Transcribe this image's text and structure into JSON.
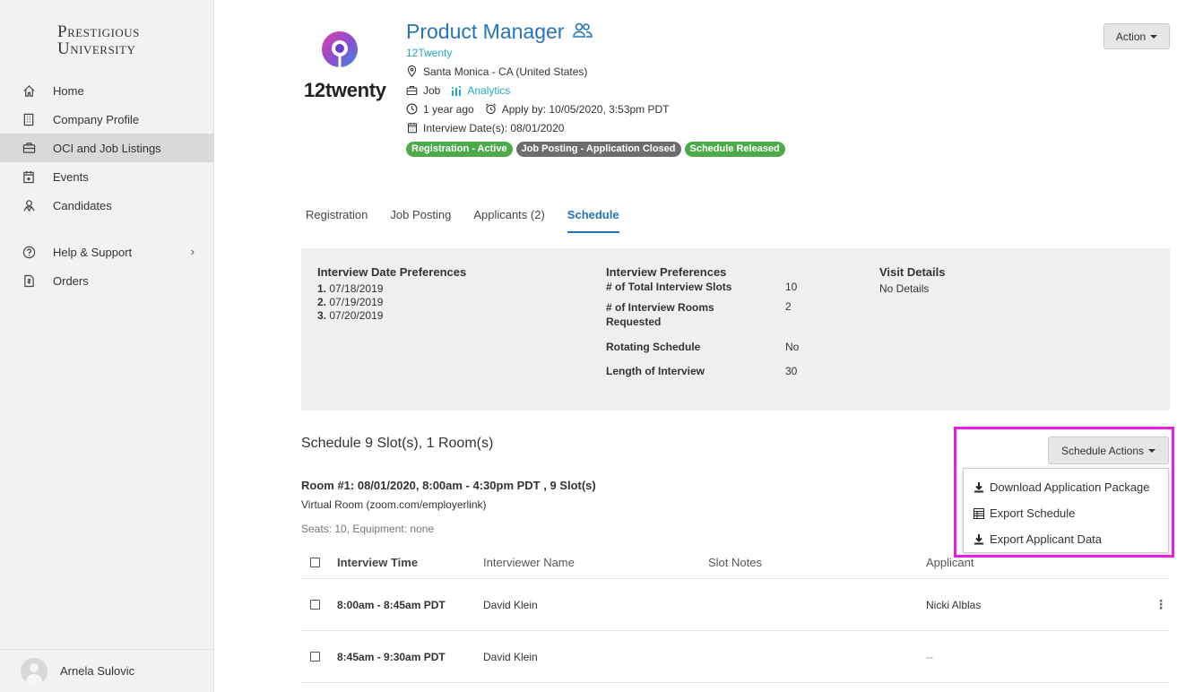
{
  "sidebar": {
    "logo_line1": "Prestigious",
    "logo_line2": "University",
    "items": [
      {
        "label": "Home",
        "icon": "home-icon"
      },
      {
        "label": "Company Profile",
        "icon": "building-icon"
      },
      {
        "label": "OCI and Job Listings",
        "icon": "briefcase-icon"
      },
      {
        "label": "Events",
        "icon": "calendar-star-icon"
      },
      {
        "label": "Candidates",
        "icon": "candidates-icon"
      },
      {
        "label": "Help & Support",
        "icon": "help-icon"
      },
      {
        "label": "Orders",
        "icon": "orders-icon"
      }
    ],
    "active_index": 2,
    "user_name": "Arnela Sulovic"
  },
  "logo": {
    "text": "12twenty"
  },
  "job": {
    "title": "Product Manager",
    "company": "12Twenty",
    "location": "Santa Monica - CA (United States)",
    "type": "Job",
    "analytics_label": "Analytics",
    "posted": "1 year ago",
    "apply_by": "Apply by: 10/05/2020, 3:53pm PDT",
    "interview_dates": "Interview Date(s): 08/01/2020",
    "badges": [
      {
        "label": "Registration - Active",
        "color": "#4caa4b"
      },
      {
        "label": "Job Posting - Application Closed",
        "color": "#6d6d6d"
      },
      {
        "label": "Schedule Released",
        "color": "#4caa4b"
      }
    ]
  },
  "action_button": "Action",
  "tabs": [
    {
      "label": "Registration"
    },
    {
      "label": "Job Posting"
    },
    {
      "label": "Applicants (2)"
    },
    {
      "label": "Schedule",
      "active": true
    }
  ],
  "preferences": {
    "date_heading": "Interview Date Preferences",
    "dates": [
      {
        "num": "1.",
        "date": "07/18/2019"
      },
      {
        "num": "2.",
        "date": "07/19/2019"
      },
      {
        "num": "3.",
        "date": "07/20/2019"
      }
    ],
    "interview_heading": "Interview Preferences",
    "rows": [
      {
        "key": "# of Total Interview Slots",
        "value": "10"
      },
      {
        "key": "# of Interview Rooms Requested",
        "value": "2"
      },
      {
        "key": "Rotating Schedule",
        "value": "No"
      },
      {
        "key": "Length of Interview",
        "value": "30"
      }
    ],
    "visit_heading": "Visit Details",
    "visit_value": "No Details"
  },
  "schedule": {
    "title": "Schedule 9 Slot(s), 1 Room(s)",
    "actions_label": "Schedule Actions",
    "menu": [
      {
        "label": "Download Application Package",
        "icon": "download-icon"
      },
      {
        "label": "Export Schedule",
        "icon": "table-icon"
      },
      {
        "label": "Export Applicant Data",
        "icon": "download-icon"
      }
    ],
    "highlight_color": "#e81fe0",
    "room_title": "Room #1: 08/01/2020, 8:00am - 4:30pm PDT , 9 Slot(s)",
    "room_virtual": "Virtual Room (zoom.com/employerlink)",
    "room_seats": "Seats: 10, Equipment: none",
    "columns": [
      "Interview Time",
      "Interviewer Name",
      "Slot Notes",
      "Applicant"
    ],
    "rows": [
      {
        "time": "8:00am - 8:45am PDT",
        "interviewer": "David Klein",
        "notes": "",
        "applicant": "Nicki Alblas"
      },
      {
        "time": "8:45am - 9:30am PDT",
        "interviewer": "David Klein",
        "notes": "",
        "applicant": "--"
      }
    ]
  }
}
